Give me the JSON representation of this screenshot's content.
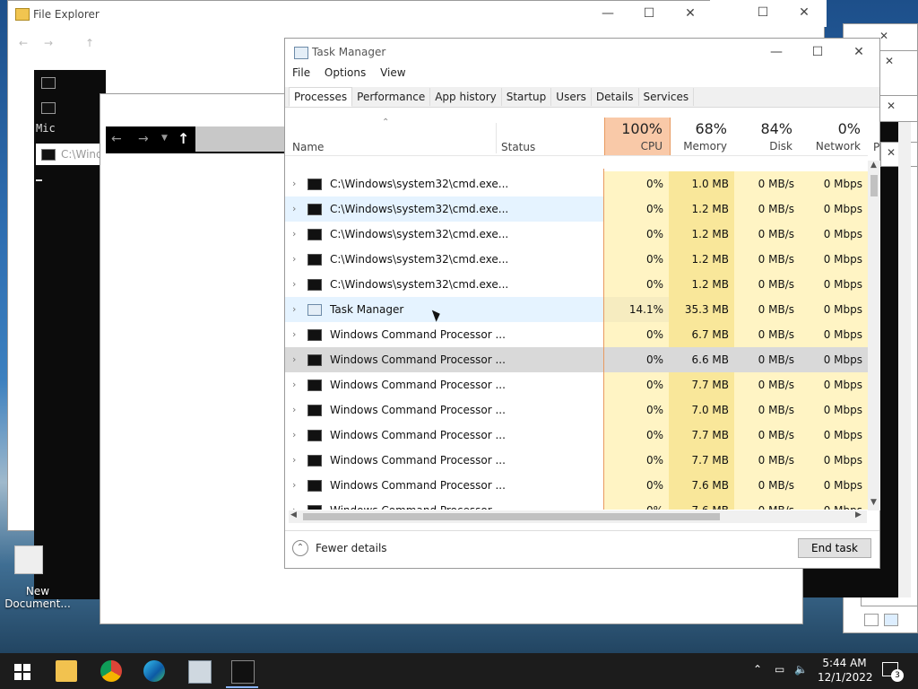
{
  "explorer": {
    "title": "File Explorer",
    "up_arrow": "↑"
  },
  "cmd_window": {
    "title": "C:\\Wind",
    "label_mid": "Mic"
  },
  "desktop": {
    "new_doc_label": "New\nDocument..."
  },
  "task_manager": {
    "title": "Task Manager",
    "menu": [
      "File",
      "Options",
      "View"
    ],
    "tabs": [
      "Processes",
      "Performance",
      "App history",
      "Startup",
      "Users",
      "Details",
      "Services"
    ],
    "active_tab": "Processes",
    "columns": {
      "name": "Name",
      "status": "Status",
      "cpu_pct": "100%",
      "cpu": "CPU",
      "mem_pct": "68%",
      "mem": "Memory",
      "disk_pct": "84%",
      "disk": "Disk",
      "net_pct": "0%",
      "net": "Network",
      "power": "P"
    },
    "processes": [
      {
        "name": "C:\\Windows\\system32\\cmd.exe...",
        "cpu": "0%",
        "mem": "1.0 MB",
        "disk": "0 MB/s",
        "net": "0 Mbps"
      },
      {
        "name": "C:\\Windows\\system32\\cmd.exe...",
        "cpu": "0%",
        "mem": "1.2 MB",
        "disk": "0 MB/s",
        "net": "0 Mbps"
      },
      {
        "name": "C:\\Windows\\system32\\cmd.exe...",
        "cpu": "0%",
        "mem": "1.2 MB",
        "disk": "0 MB/s",
        "net": "0 Mbps"
      },
      {
        "name": "C:\\Windows\\system32\\cmd.exe...",
        "cpu": "0%",
        "mem": "1.2 MB",
        "disk": "0 MB/s",
        "net": "0 Mbps"
      },
      {
        "name": "C:\\Windows\\system32\\cmd.exe...",
        "cpu": "0%",
        "mem": "1.2 MB",
        "disk": "0 MB/s",
        "net": "0 Mbps"
      },
      {
        "name": "Task Manager",
        "cpu": "14.1%",
        "mem": "35.3 MB",
        "disk": "0 MB/s",
        "net": "0 Mbps"
      },
      {
        "name": "Windows Command Processor ...",
        "cpu": "0%",
        "mem": "6.7 MB",
        "disk": "0 MB/s",
        "net": "0 Mbps"
      },
      {
        "name": "Windows Command Processor ...",
        "cpu": "0%",
        "mem": "6.6 MB",
        "disk": "0 MB/s",
        "net": "0 Mbps"
      },
      {
        "name": "Windows Command Processor ...",
        "cpu": "0%",
        "mem": "7.7 MB",
        "disk": "0 MB/s",
        "net": "0 Mbps"
      },
      {
        "name": "Windows Command Processor ...",
        "cpu": "0%",
        "mem": "7.0 MB",
        "disk": "0 MB/s",
        "net": "0 Mbps"
      },
      {
        "name": "Windows Command Processor ...",
        "cpu": "0%",
        "mem": "7.7 MB",
        "disk": "0 MB/s",
        "net": "0 Mbps"
      },
      {
        "name": "Windows Command Processor ...",
        "cpu": "0%",
        "mem": "7.7 MB",
        "disk": "0 MB/s",
        "net": "0 Mbps"
      },
      {
        "name": "Windows Command Processor ...",
        "cpu": "0%",
        "mem": "7.6 MB",
        "disk": "0 MB/s",
        "net": "0 Mbps"
      },
      {
        "name": "Windows Command Processor ...",
        "cpu": "0%",
        "mem": "7.6 MB",
        "disk": "0 MB/s",
        "net": "0 Mbps"
      }
    ],
    "fewer_details": "Fewer details",
    "end_task": "End task"
  },
  "taskbar": {
    "time": "5:44 AM",
    "date": "12/1/2022",
    "notification_count": "3"
  },
  "colors": {
    "cpu_header_bg": "#f9c9a8",
    "cell_yellow": "#fff4c4",
    "cell_yellow_dark": "#f9e79a",
    "selected_row": "#d9d9d9",
    "hover_row": "#e5f3ff"
  }
}
